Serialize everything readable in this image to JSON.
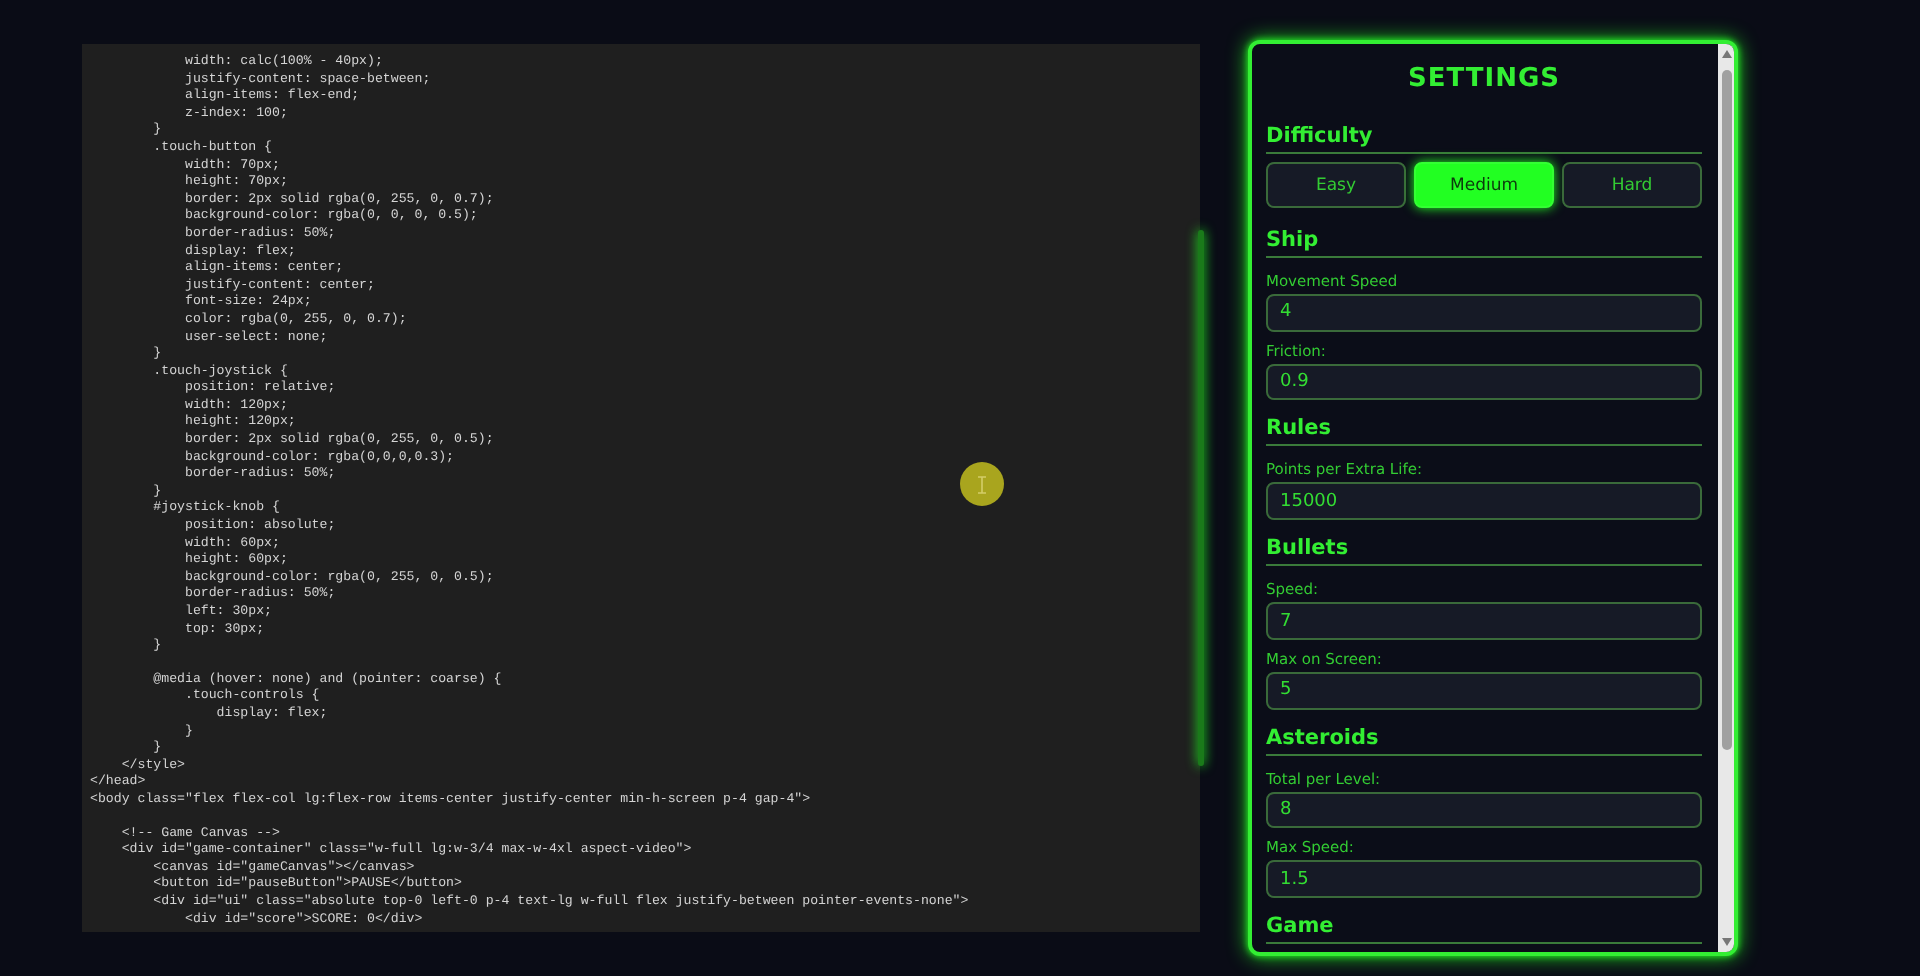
{
  "code_editor": {
    "blocks": [
      [
        "            width: calc(100% - 40px);",
        "            justify-content: space-between;",
        "            align-items: flex-end;",
        "            z-index: 100;",
        "        }",
        "        .touch-button {",
        "            width: 70px;",
        "            height: 70px;",
        "            border: 2px solid rgba(0, 255, 0, 0.7);",
        "            background-color: rgba(0, 0, 0, 0.5);",
        "            border-radius: 50%;",
        "            display: flex;",
        "            align-items: center;",
        "            justify-content: center;",
        "            font-size: 24px;",
        "            color: rgba(0, 255, 0, 0.7);",
        "            user-select: none;",
        "        }",
        "        .touch-joystick {",
        "            position: relative;",
        "            width: 120px;",
        "            height: 120px;",
        "            border: 2px solid rgba(0, 255, 0, 0.5);",
        "            background-color: rgba(0,0,0,0.3);",
        "            border-radius: 50%;",
        "        }",
        "        #joystick-knob {",
        "            position: absolute;",
        "            width: 60px;",
        "            height: 60px;",
        "            background-color: rgba(0, 255, 0, 0.5);",
        "            border-radius: 50%;",
        "            left: 30px;",
        "            top: 30px;",
        "        }"
      ],
      [
        "        @media (hover: none) and (pointer: coarse) {",
        "            .touch-controls {",
        "                display: flex;",
        "            }",
        "        }",
        "    </style>",
        "</head>",
        "<body class=\"flex flex-col lg:flex-row items-center justify-center min-h-screen p-4 gap-4\">"
      ],
      [
        "    <!-- Game Canvas -->",
        "    <div id=\"game-container\" class=\"w-full lg:w-3/4 max-w-4xl aspect-video\">",
        "        <canvas id=\"gameCanvas\"></canvas>",
        "        <button id=\"pauseButton\">PAUSE</button>",
        "        <div id=\"ui\" class=\"absolute top-0 left-0 p-4 text-lg w-full flex justify-between pointer-events-none\">",
        "            <div id=\"score\">SCORE: 0</div>"
      ]
    ]
  },
  "settings": {
    "title": "SETTINGS",
    "difficulty": {
      "title": "Difficulty",
      "options": [
        {
          "label": "Easy",
          "selected": false
        },
        {
          "label": "Medium",
          "selected": true
        },
        {
          "label": "Hard",
          "selected": false
        }
      ]
    },
    "sections": [
      {
        "title": "Ship",
        "fields": [
          {
            "label": "Movement Speed",
            "value": "4"
          },
          {
            "label": "Friction:",
            "value": "0.9"
          }
        ]
      },
      {
        "title": "Rules",
        "fields": [
          {
            "label": "Points per Extra Life:",
            "value": "15000"
          }
        ]
      },
      {
        "title": "Bullets",
        "fields": [
          {
            "label": "Speed:",
            "value": "7"
          },
          {
            "label": "Max on Screen:",
            "value": "5"
          }
        ]
      },
      {
        "title": "Asteroids",
        "fields": [
          {
            "label": "Total per Level:",
            "value": "8"
          },
          {
            "label": "Max Speed:",
            "value": "1.5"
          }
        ]
      },
      {
        "title": "Game"
      }
    ]
  }
}
